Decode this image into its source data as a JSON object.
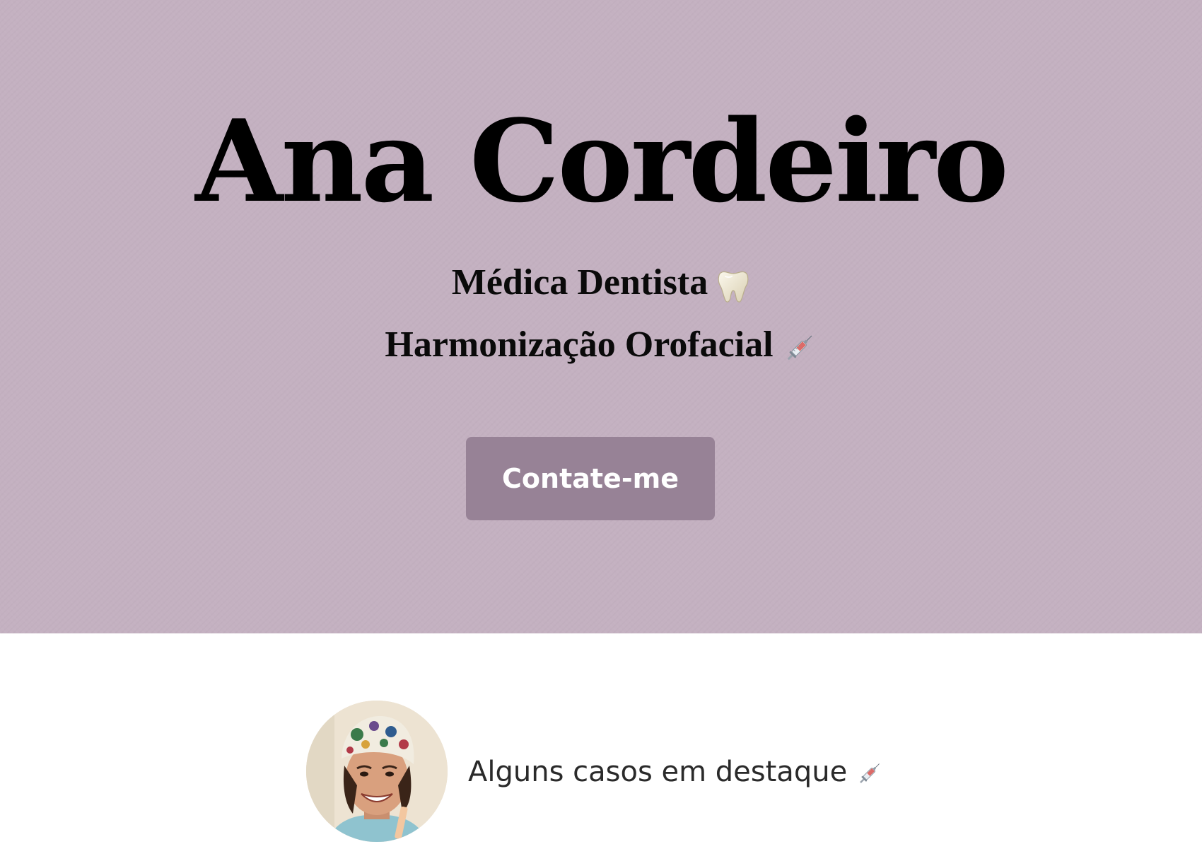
{
  "hero": {
    "title": "Ana Cordeiro",
    "line1": {
      "text": "Médica Dentista",
      "icon": "tooth-icon"
    },
    "line2": {
      "text": "Harmonização Orofacial",
      "icon": "syringe-icon"
    },
    "cta_label": "Contate-me",
    "background_color": "#c4b1c1",
    "button_color": "#978296"
  },
  "section": {
    "avatar_icon": "profile-photo",
    "heading": "Alguns casos em destaque",
    "heading_icon": "syringe-icon"
  }
}
